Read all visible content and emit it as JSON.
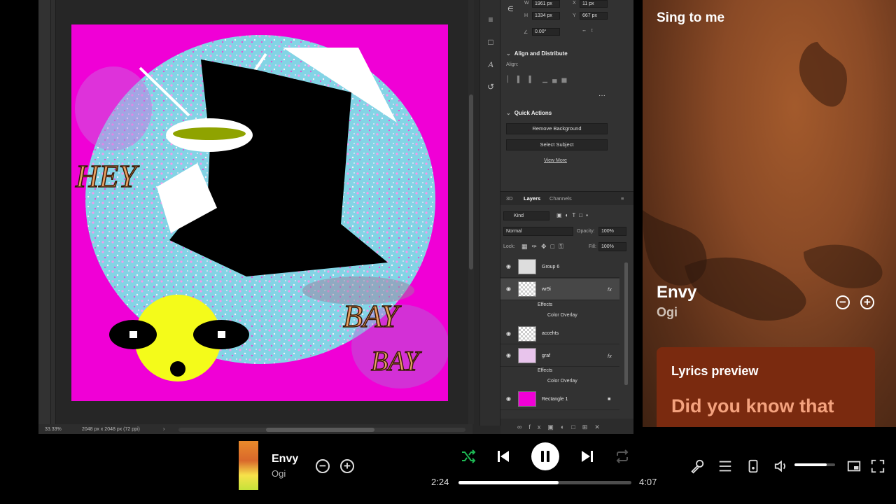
{
  "photoshop": {
    "status": {
      "zoom": "33.33%",
      "doc_info": "2048 px x 2048 px (72 ppi)"
    },
    "properties": {
      "w_label": "W",
      "w_value": "1961 px",
      "h_label": "H",
      "h_value": "1334 px",
      "x_label": "X",
      "x_value": "11 px",
      "y_label": "Y",
      "y_value": "667 px",
      "angle_value": "0.00°"
    },
    "align": {
      "title": "Align and Distribute",
      "label": "Align:"
    },
    "quick_actions": {
      "title": "Quick Actions",
      "remove_bg": "Remove Background",
      "select_subject": "Select Subject",
      "view_more": "View More"
    },
    "layers_panel": {
      "tabs": [
        "3D",
        "Layers",
        "Channels"
      ],
      "filter": "Kind",
      "blend_mode": "Normal",
      "opacity_label": "Opacity:",
      "opacity_value": "100%",
      "lock_label": "Lock:",
      "fill_label": "Fill:",
      "fill_value": "100%",
      "layers": [
        {
          "name": "Group 6"
        },
        {
          "name": "wr9i",
          "fx": "fx",
          "effects_label": "Effects",
          "effect": "Color Overlay"
        },
        {
          "name": "accehts"
        },
        {
          "name": "graf",
          "fx": "fx",
          "effects_label": "Effects",
          "effect": "Color Overlay"
        },
        {
          "name": "Rectangle 1"
        }
      ]
    },
    "artwork": {
      "text_hey": "HEY",
      "text_bay1": "BAY",
      "text_bay2": "BAY"
    }
  },
  "now_playing": {
    "playlist": "Sing to me",
    "title": "Envy",
    "artist": "Ogi",
    "lyrics_card_title": "Lyrics preview",
    "lyrics_line": "Did you know that"
  },
  "player": {
    "title": "Envy",
    "artist": "Ogi",
    "elapsed": "2:24",
    "total": "4:07",
    "progress_fraction": 0.58,
    "volume_fraction": 0.8
  },
  "colors": {
    "artboard_magenta": "#f000d6",
    "splatter_cyan": "#6ee8e8",
    "face_yellow": "#f4fb1a",
    "shuffle_green": "#1db954",
    "lyrics_card": "#7a2a0f"
  }
}
